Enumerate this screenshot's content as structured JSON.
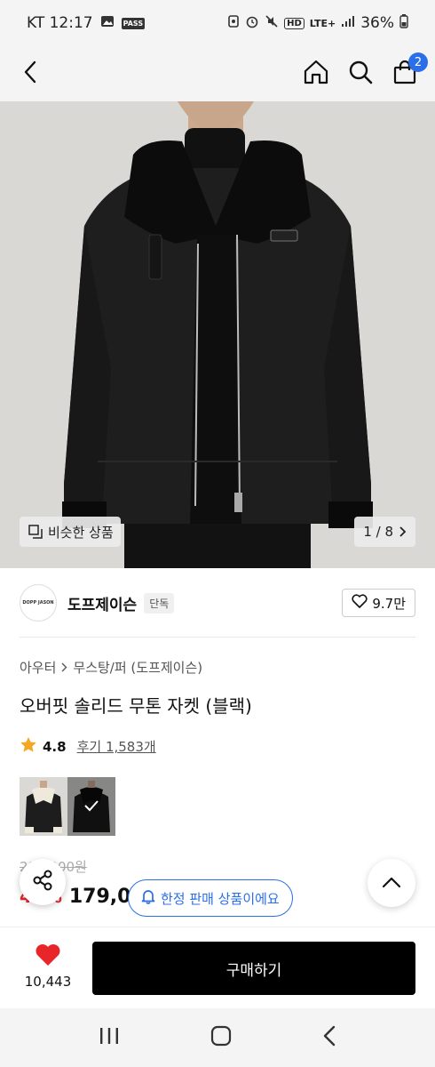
{
  "status_bar": {
    "carrier_time": "KT 12:17",
    "pass_label": "PASS",
    "hd_label": "HD",
    "lte_label": "LTE+",
    "battery": "36%"
  },
  "top_nav": {
    "back_icon": "chevron-left-icon",
    "home_icon": "home-icon",
    "search_icon": "search-icon",
    "cart_icon": "shopping-bag-icon",
    "cart_count": "2",
    "accent": "#2b6fe8"
  },
  "hero": {
    "similar_label": "비슷한 상품",
    "page_counter": "1 / 8"
  },
  "brand": {
    "logo_text": "DOPP JASON",
    "name": "도프제이슨",
    "tag": "단독",
    "likes": "9.7만"
  },
  "product": {
    "breadcrumb": [
      "아우터",
      "무스탕/퍼 (도프제이슨)"
    ],
    "title": "오버핏 솔리드 무톤 자켓 (블랙)",
    "rating": "4.8",
    "review_link": "후기 1,583개",
    "original_price": "299,000원",
    "discount": "40%",
    "sale_price": "179,000원"
  },
  "limited_notice": "한정 판매 상품이에요",
  "bottom_bar": {
    "wish_count": "10,443",
    "buy_label": "구매하기",
    "heart_color": "#e8262a"
  }
}
